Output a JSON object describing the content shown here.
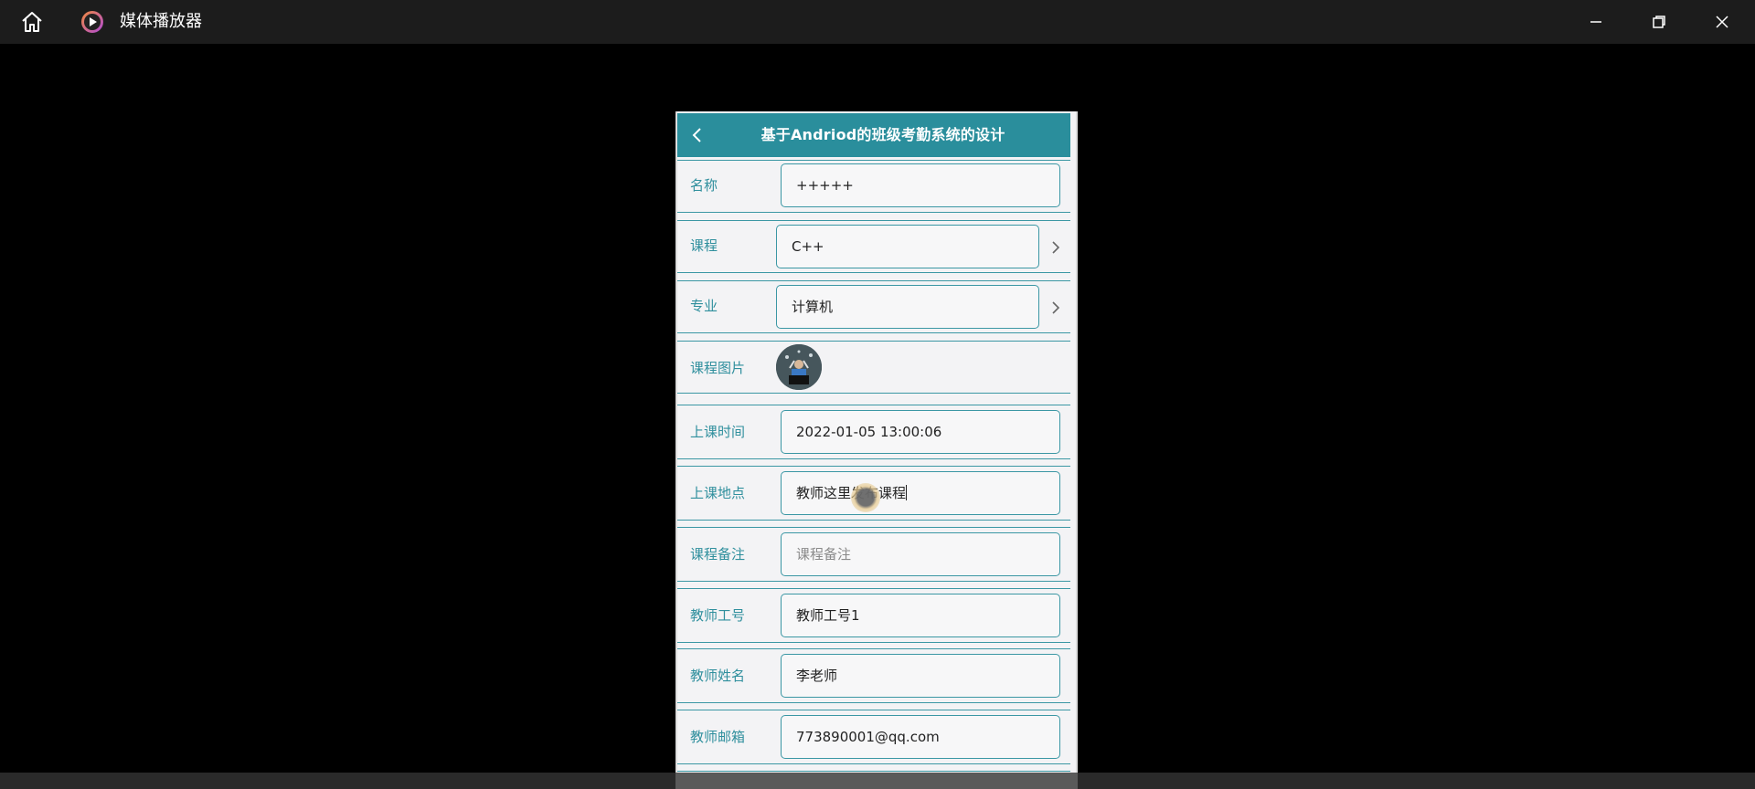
{
  "window": {
    "title": "媒体播放器"
  },
  "app": {
    "header_title": "基于Andriod的班级考勤系统的设计"
  },
  "form": {
    "rows": [
      {
        "label": "名称",
        "value": "+++++"
      },
      {
        "label": "课程",
        "value": "C++"
      },
      {
        "label": "专业",
        "value": "计算机"
      },
      {
        "label": "课程图片"
      },
      {
        "label": "上课时间",
        "value": "2022-01-05 13:00:06"
      },
      {
        "label": "上课地点",
        "value": "教师这里发布课程"
      },
      {
        "label": "课程备注",
        "placeholder": "课程备注"
      },
      {
        "label": "教师工号",
        "value": "教师工号1"
      },
      {
        "label": "教师姓名",
        "value": "李老师"
      },
      {
        "label": "教师邮箱",
        "value": "773890001@qq.com"
      }
    ]
  },
  "colors": {
    "header_bg": "#2a8e9c",
    "label_text": "#2f8f9d",
    "border": "#3b97a4"
  },
  "icons": {
    "home": "home-icon",
    "app": "media-player-logo-icon",
    "minimize": "minimize-icon",
    "maximize": "restore-icon",
    "close": "close-icon",
    "back": "back-chevron-icon",
    "chevron": "chevron-right-icon"
  }
}
